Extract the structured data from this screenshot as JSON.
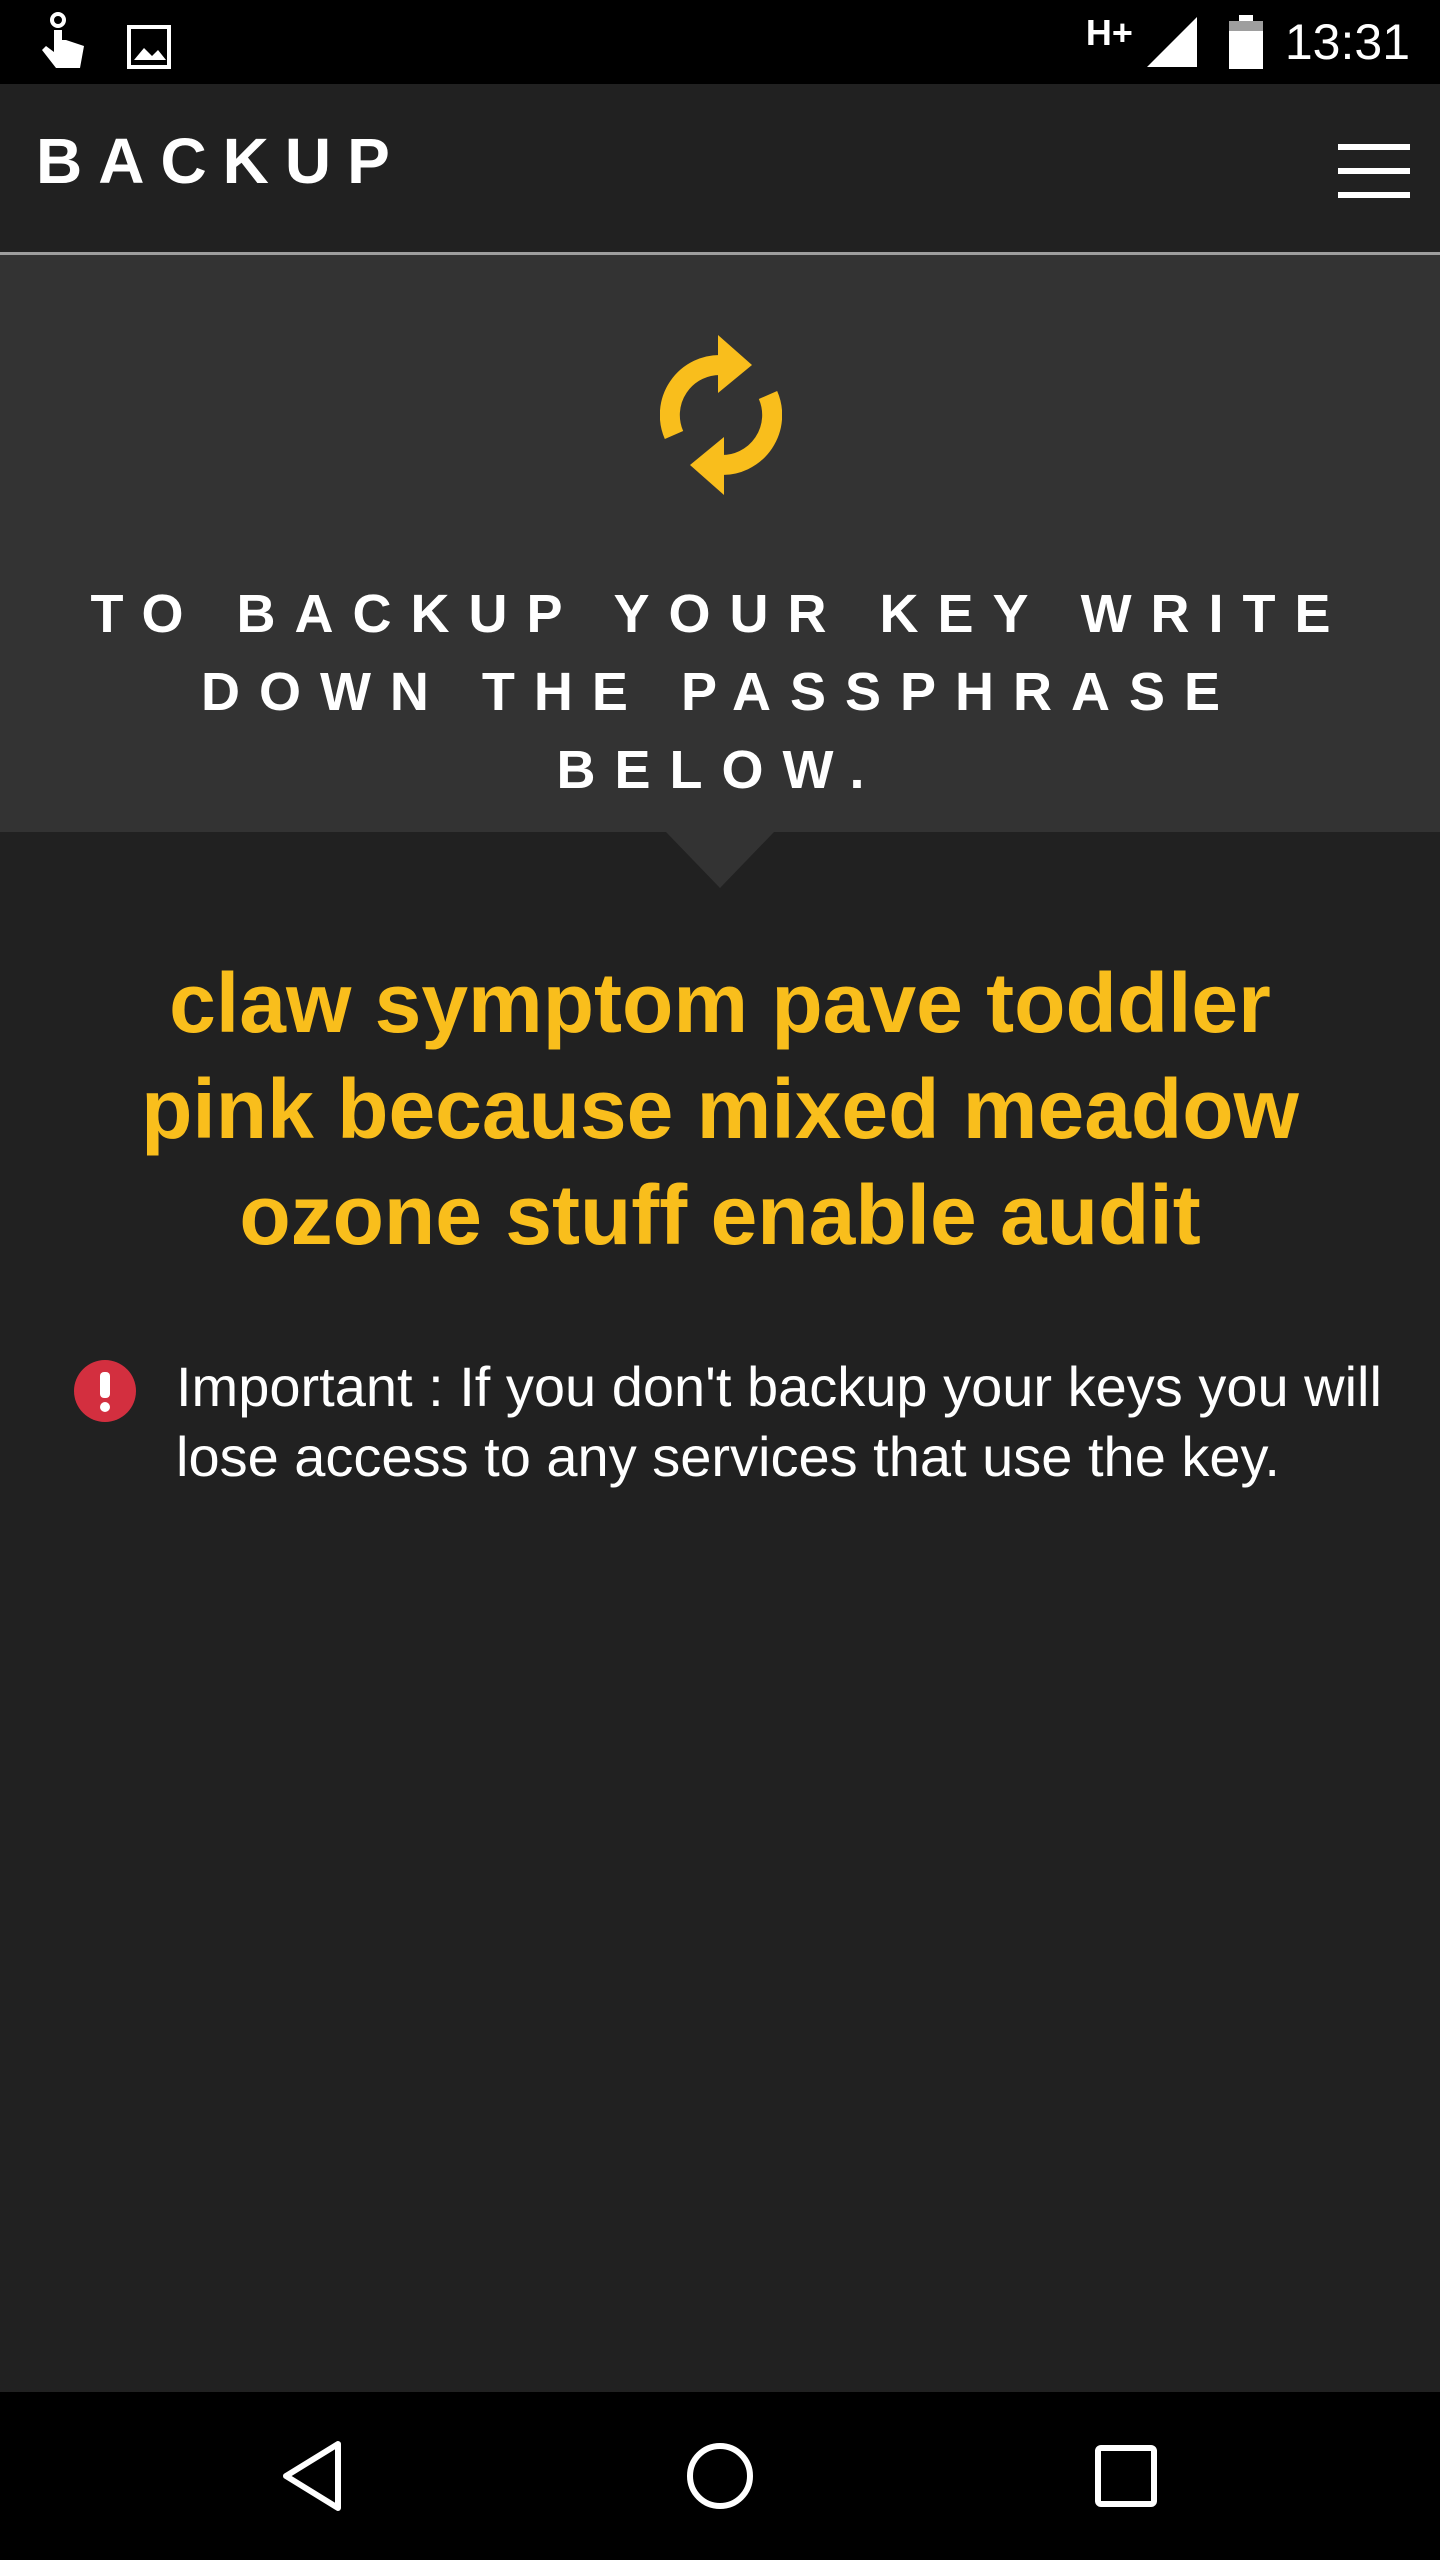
{
  "status_bar": {
    "icons_left": [
      "touch-icon",
      "image-icon"
    ],
    "network_type": "H+",
    "icons_right": [
      "signal-icon",
      "battery-icon"
    ],
    "time": "13:31"
  },
  "app_bar": {
    "title": "BACKUP",
    "menu_icon": "hamburger-menu-icon"
  },
  "header": {
    "icon": "sync-icon",
    "instruction_line1": "TO BACKUP YOUR KEY WRITE",
    "instruction_line2": "DOWN THE PASSPHRASE BELOW."
  },
  "passphrase": {
    "line1": "claw symptom pave toddler",
    "line2": "pink because mixed meadow",
    "line3": "ozone stuff enable audit"
  },
  "warning": {
    "icon": "alert-icon",
    "text": "Important : If you don't backup your keys you will lose access to any services that use the key."
  },
  "nav_bar": {
    "buttons": [
      "back-icon",
      "home-icon",
      "recents-icon"
    ]
  },
  "colors": {
    "accent": "#f9be1c",
    "background": "#212121",
    "header_panel": "#333333",
    "alert": "#d32f3f"
  }
}
